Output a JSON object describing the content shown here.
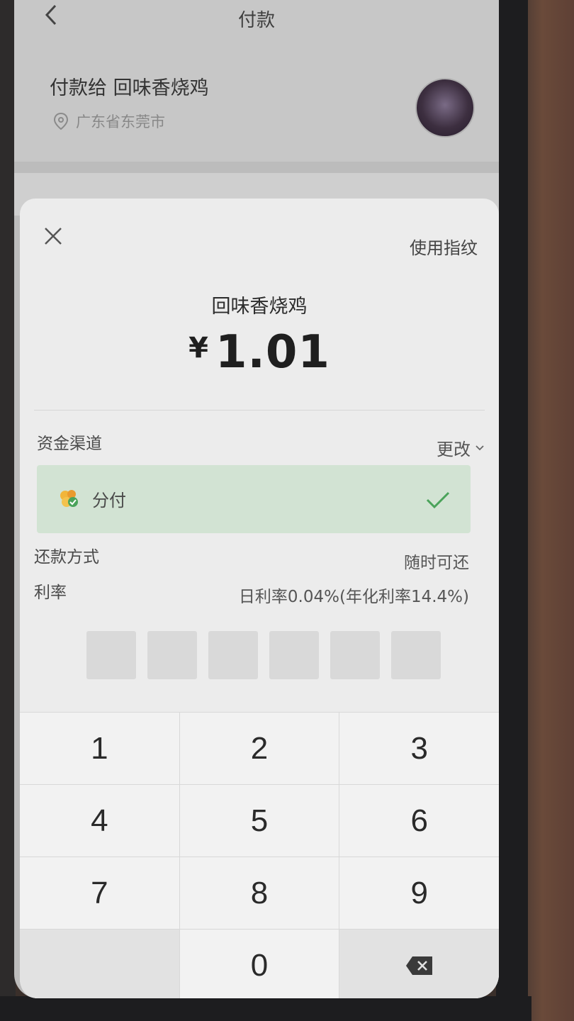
{
  "background_page": {
    "title": "付款",
    "payee": "付款给 回味香烧鸡",
    "location": "广东省东莞市"
  },
  "sheet": {
    "fingerprint_label": "使用指纹",
    "merchant": "回味香烧鸡",
    "currency_symbol": "¥",
    "amount": "1.01",
    "funding_label": "资金渠道",
    "change_label": "更改",
    "channel_name": "分付",
    "repayment_label": "还款方式",
    "repayment_value": "随时可还",
    "rate_label": "利率",
    "rate_value": "日利率0.04%(年化利率14.4%)",
    "pin_length": 6,
    "pin_filled": 0
  },
  "keypad": {
    "keys": [
      "1",
      "2",
      "3",
      "4",
      "5",
      "6",
      "7",
      "8",
      "9",
      "",
      "0",
      "backspace"
    ]
  },
  "colors": {
    "channel_selected_bg": "#d2e3d3",
    "check_green": "#4aa35a"
  }
}
